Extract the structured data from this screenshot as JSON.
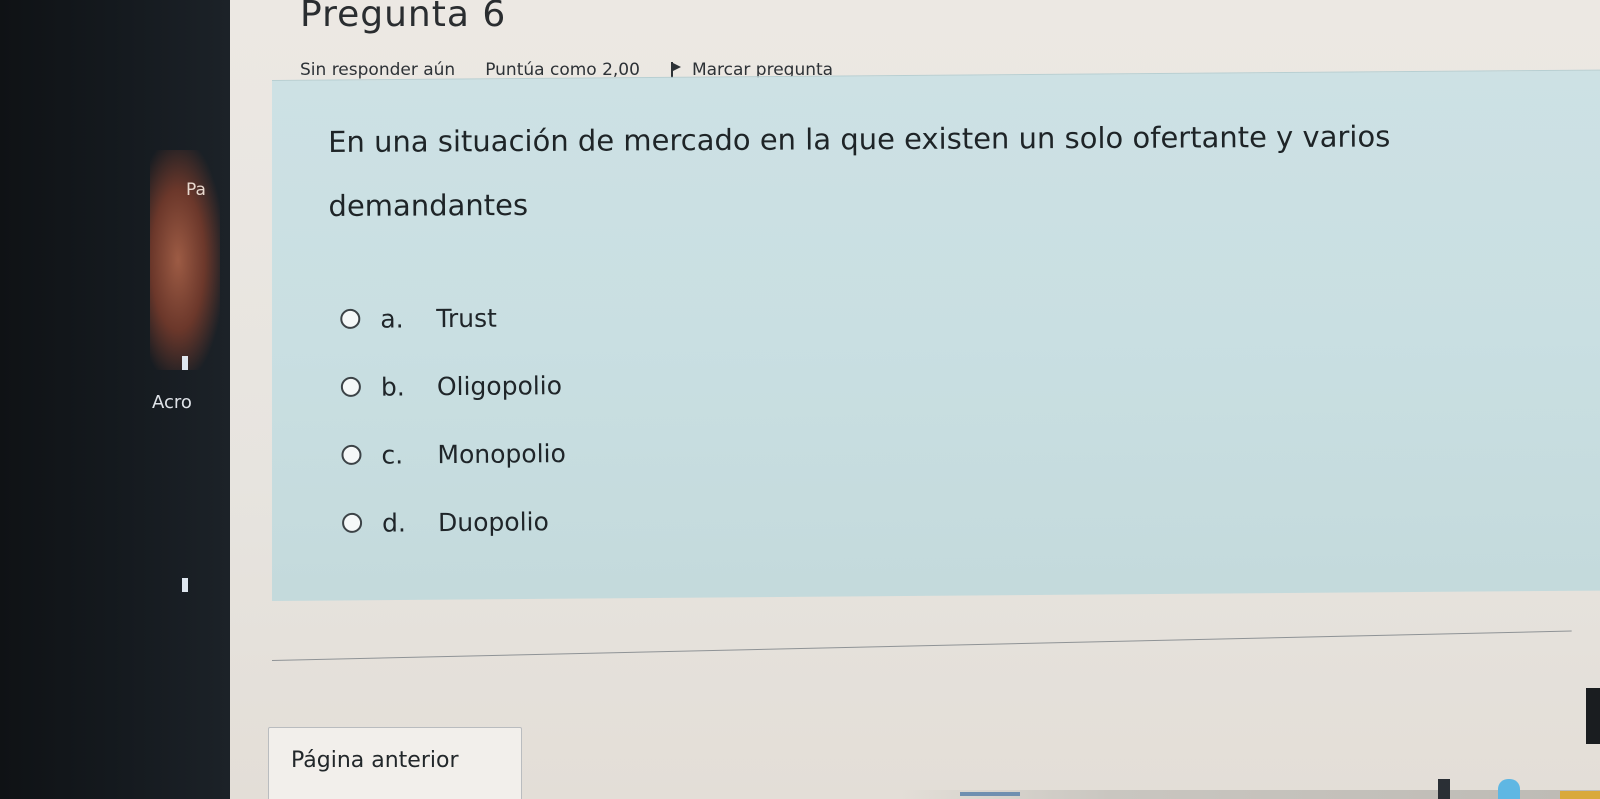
{
  "side": {
    "label_pa": "Pa",
    "label_acro": "Acro"
  },
  "question": {
    "title": "Pregunta 6",
    "status": "Sin responder aún",
    "score": "Puntúa como 2,00",
    "flag_label": "Marcar pregunta",
    "text": "En una situación de mercado en la que existen un solo ofertante y varios demandantes",
    "answers": [
      {
        "letter": "a.",
        "text": "Trust"
      },
      {
        "letter": "b.",
        "text": "Oligopolio"
      },
      {
        "letter": "c.",
        "text": "Monopolio"
      },
      {
        "letter": "d.",
        "text": "Duopolio"
      }
    ]
  },
  "navigation": {
    "prev_label": "Página anterior"
  },
  "colors": {
    "panel": "#cde1e4",
    "page": "#e9e5df",
    "sidebar": "#151a1f"
  }
}
